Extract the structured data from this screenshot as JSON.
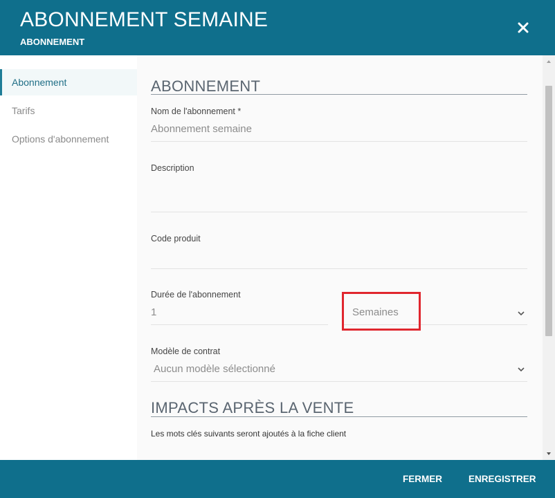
{
  "header": {
    "title": "ABONNEMENT SEMAINE",
    "subtitle": "ABONNEMENT",
    "close_icon": "close-icon"
  },
  "sidebar": {
    "items": [
      {
        "label": "Abonnement",
        "active": true
      },
      {
        "label": "Tarifs",
        "active": false
      },
      {
        "label": "Options d'abonnement",
        "active": false
      }
    ]
  },
  "form": {
    "section_title": "ABONNEMENT",
    "name": {
      "label": "Nom de l'abonnement *",
      "value": "Abonnement semaine"
    },
    "description": {
      "label": "Description",
      "value": ""
    },
    "product_code": {
      "label": "Code produit",
      "value": ""
    },
    "duration": {
      "label": "Durée de l'abonnement",
      "value": "1",
      "unit": "Semaines"
    },
    "contract_model": {
      "label": "Modèle de contrat",
      "value": "Aucun modèle sélectionné"
    },
    "impacts_title": "IMPACTS APRÈS LA VENTE",
    "impacts_text": "Les mots clés suivants seront ajoutés à la fiche client"
  },
  "footer": {
    "close_label": "FERMER",
    "save_label": "ENREGISTRER"
  },
  "colors": {
    "header_bg": "#0f6f8c",
    "accent": "#1f7d97",
    "highlight": "#e0262e"
  }
}
